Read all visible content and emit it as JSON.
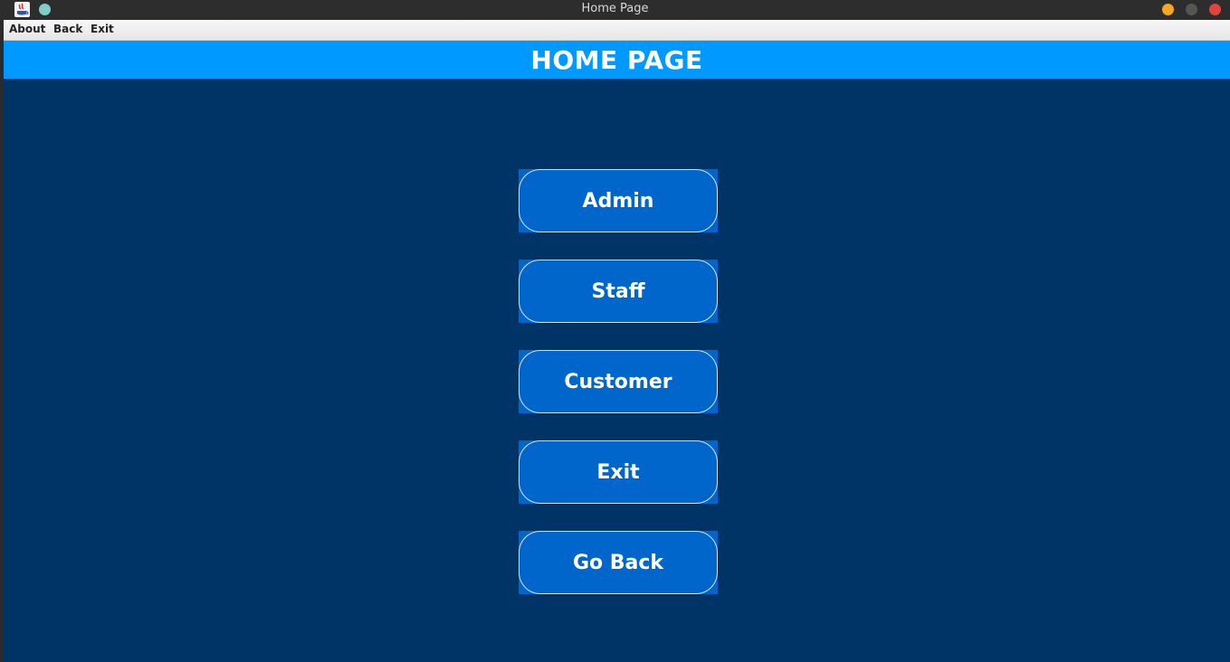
{
  "window": {
    "title": "Home Page",
    "app_icon": "java-app-icon",
    "controls": {
      "minimize_color": "#f5a623",
      "maximize_color": "#555555",
      "close_color": "#e0443e"
    }
  },
  "menubar": {
    "items": [
      {
        "label": "About"
      },
      {
        "label": "Back"
      },
      {
        "label": "Exit"
      }
    ]
  },
  "header": {
    "title": "HOME PAGE"
  },
  "main": {
    "buttons": [
      {
        "label": "Admin"
      },
      {
        "label": "Staff"
      },
      {
        "label": "Customer"
      },
      {
        "label": "Exit"
      },
      {
        "label": "Go Back"
      }
    ]
  },
  "colors": {
    "header_band": "#0099ff",
    "background": "#003366",
    "button_fill": "#0066cc",
    "pin_dot": "#7fcfc5"
  }
}
